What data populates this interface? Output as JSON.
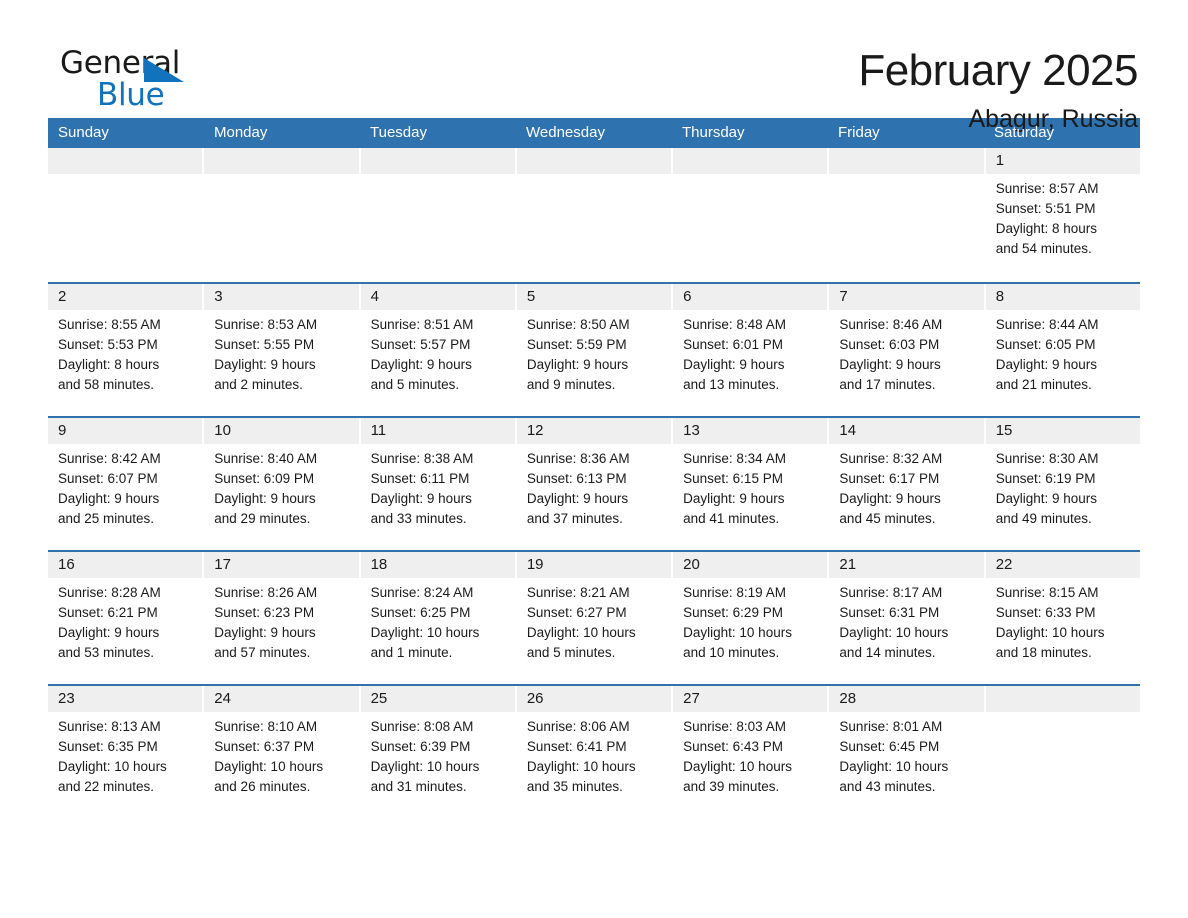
{
  "brand": {
    "name_part1": "General",
    "name_part2": "Blue",
    "accent_color": "#1173bd"
  },
  "header": {
    "month_title": "February 2025",
    "location": "Abagur, Russia"
  },
  "theme": {
    "header_blue": "#2e72b0",
    "daynum_band": "#efefef",
    "text": "#1a1a1a"
  },
  "weekdays": [
    "Sunday",
    "Monday",
    "Tuesday",
    "Wednesday",
    "Thursday",
    "Friday",
    "Saturday"
  ],
  "weeks": [
    [
      {
        "day": "",
        "sunrise": "",
        "sunset": "",
        "daylight1": "",
        "daylight2": ""
      },
      {
        "day": "",
        "sunrise": "",
        "sunset": "",
        "daylight1": "",
        "daylight2": ""
      },
      {
        "day": "",
        "sunrise": "",
        "sunset": "",
        "daylight1": "",
        "daylight2": ""
      },
      {
        "day": "",
        "sunrise": "",
        "sunset": "",
        "daylight1": "",
        "daylight2": ""
      },
      {
        "day": "",
        "sunrise": "",
        "sunset": "",
        "daylight1": "",
        "daylight2": ""
      },
      {
        "day": "",
        "sunrise": "",
        "sunset": "",
        "daylight1": "",
        "daylight2": ""
      },
      {
        "day": "1",
        "sunrise": "Sunrise: 8:57 AM",
        "sunset": "Sunset: 5:51 PM",
        "daylight1": "Daylight: 8 hours",
        "daylight2": "and 54 minutes."
      }
    ],
    [
      {
        "day": "2",
        "sunrise": "Sunrise: 8:55 AM",
        "sunset": "Sunset: 5:53 PM",
        "daylight1": "Daylight: 8 hours",
        "daylight2": "and 58 minutes."
      },
      {
        "day": "3",
        "sunrise": "Sunrise: 8:53 AM",
        "sunset": "Sunset: 5:55 PM",
        "daylight1": "Daylight: 9 hours",
        "daylight2": "and 2 minutes."
      },
      {
        "day": "4",
        "sunrise": "Sunrise: 8:51 AM",
        "sunset": "Sunset: 5:57 PM",
        "daylight1": "Daylight: 9 hours",
        "daylight2": "and 5 minutes."
      },
      {
        "day": "5",
        "sunrise": "Sunrise: 8:50 AM",
        "sunset": "Sunset: 5:59 PM",
        "daylight1": "Daylight: 9 hours",
        "daylight2": "and 9 minutes."
      },
      {
        "day": "6",
        "sunrise": "Sunrise: 8:48 AM",
        "sunset": "Sunset: 6:01 PM",
        "daylight1": "Daylight: 9 hours",
        "daylight2": "and 13 minutes."
      },
      {
        "day": "7",
        "sunrise": "Sunrise: 8:46 AM",
        "sunset": "Sunset: 6:03 PM",
        "daylight1": "Daylight: 9 hours",
        "daylight2": "and 17 minutes."
      },
      {
        "day": "8",
        "sunrise": "Sunrise: 8:44 AM",
        "sunset": "Sunset: 6:05 PM",
        "daylight1": "Daylight: 9 hours",
        "daylight2": "and 21 minutes."
      }
    ],
    [
      {
        "day": "9",
        "sunrise": "Sunrise: 8:42 AM",
        "sunset": "Sunset: 6:07 PM",
        "daylight1": "Daylight: 9 hours",
        "daylight2": "and 25 minutes."
      },
      {
        "day": "10",
        "sunrise": "Sunrise: 8:40 AM",
        "sunset": "Sunset: 6:09 PM",
        "daylight1": "Daylight: 9 hours",
        "daylight2": "and 29 minutes."
      },
      {
        "day": "11",
        "sunrise": "Sunrise: 8:38 AM",
        "sunset": "Sunset: 6:11 PM",
        "daylight1": "Daylight: 9 hours",
        "daylight2": "and 33 minutes."
      },
      {
        "day": "12",
        "sunrise": "Sunrise: 8:36 AM",
        "sunset": "Sunset: 6:13 PM",
        "daylight1": "Daylight: 9 hours",
        "daylight2": "and 37 minutes."
      },
      {
        "day": "13",
        "sunrise": "Sunrise: 8:34 AM",
        "sunset": "Sunset: 6:15 PM",
        "daylight1": "Daylight: 9 hours",
        "daylight2": "and 41 minutes."
      },
      {
        "day": "14",
        "sunrise": "Sunrise: 8:32 AM",
        "sunset": "Sunset: 6:17 PM",
        "daylight1": "Daylight: 9 hours",
        "daylight2": "and 45 minutes."
      },
      {
        "day": "15",
        "sunrise": "Sunrise: 8:30 AM",
        "sunset": "Sunset: 6:19 PM",
        "daylight1": "Daylight: 9 hours",
        "daylight2": "and 49 minutes."
      }
    ],
    [
      {
        "day": "16",
        "sunrise": "Sunrise: 8:28 AM",
        "sunset": "Sunset: 6:21 PM",
        "daylight1": "Daylight: 9 hours",
        "daylight2": "and 53 minutes."
      },
      {
        "day": "17",
        "sunrise": "Sunrise: 8:26 AM",
        "sunset": "Sunset: 6:23 PM",
        "daylight1": "Daylight: 9 hours",
        "daylight2": "and 57 minutes."
      },
      {
        "day": "18",
        "sunrise": "Sunrise: 8:24 AM",
        "sunset": "Sunset: 6:25 PM",
        "daylight1": "Daylight: 10 hours",
        "daylight2": "and 1 minute."
      },
      {
        "day": "19",
        "sunrise": "Sunrise: 8:21 AM",
        "sunset": "Sunset: 6:27 PM",
        "daylight1": "Daylight: 10 hours",
        "daylight2": "and 5 minutes."
      },
      {
        "day": "20",
        "sunrise": "Sunrise: 8:19 AM",
        "sunset": "Sunset: 6:29 PM",
        "daylight1": "Daylight: 10 hours",
        "daylight2": "and 10 minutes."
      },
      {
        "day": "21",
        "sunrise": "Sunrise: 8:17 AM",
        "sunset": "Sunset: 6:31 PM",
        "daylight1": "Daylight: 10 hours",
        "daylight2": "and 14 minutes."
      },
      {
        "day": "22",
        "sunrise": "Sunrise: 8:15 AM",
        "sunset": "Sunset: 6:33 PM",
        "daylight1": "Daylight: 10 hours",
        "daylight2": "and 18 minutes."
      }
    ],
    [
      {
        "day": "23",
        "sunrise": "Sunrise: 8:13 AM",
        "sunset": "Sunset: 6:35 PM",
        "daylight1": "Daylight: 10 hours",
        "daylight2": "and 22 minutes."
      },
      {
        "day": "24",
        "sunrise": "Sunrise: 8:10 AM",
        "sunset": "Sunset: 6:37 PM",
        "daylight1": "Daylight: 10 hours",
        "daylight2": "and 26 minutes."
      },
      {
        "day": "25",
        "sunrise": "Sunrise: 8:08 AM",
        "sunset": "Sunset: 6:39 PM",
        "daylight1": "Daylight: 10 hours",
        "daylight2": "and 31 minutes."
      },
      {
        "day": "26",
        "sunrise": "Sunrise: 8:06 AM",
        "sunset": "Sunset: 6:41 PM",
        "daylight1": "Daylight: 10 hours",
        "daylight2": "and 35 minutes."
      },
      {
        "day": "27",
        "sunrise": "Sunrise: 8:03 AM",
        "sunset": "Sunset: 6:43 PM",
        "daylight1": "Daylight: 10 hours",
        "daylight2": "and 39 minutes."
      },
      {
        "day": "28",
        "sunrise": "Sunrise: 8:01 AM",
        "sunset": "Sunset: 6:45 PM",
        "daylight1": "Daylight: 10 hours",
        "daylight2": "and 43 minutes."
      },
      {
        "day": "",
        "sunrise": "",
        "sunset": "",
        "daylight1": "",
        "daylight2": ""
      }
    ]
  ]
}
